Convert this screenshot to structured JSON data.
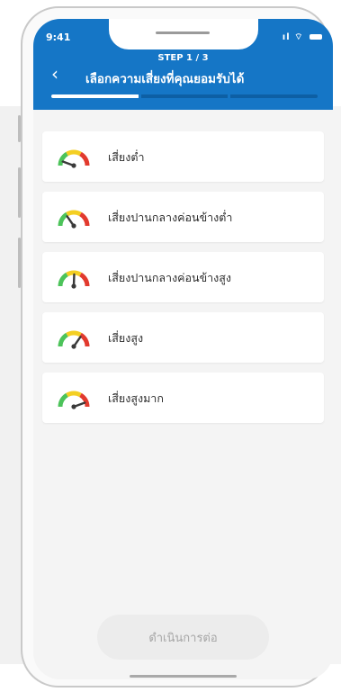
{
  "status_bar": {
    "time": "9:41",
    "icons": [
      "signal-icon",
      "wifi-icon",
      "battery-icon"
    ]
  },
  "header": {
    "back_icon": "chevron-left-icon",
    "step": "STEP 1 / 3",
    "title": "เลือกความเสี่ยงที่คุณยอมรับได้",
    "progress_fraction": 0.33,
    "progress_segments": 3
  },
  "options": [
    {
      "label": "เสี่ยงต่ำ",
      "icon": "gauge-low-icon",
      "level": 1
    },
    {
      "label": "เสี่ยงปานกลางค่อนข้างต่ำ",
      "icon": "gauge-medium-low-icon",
      "level": 2
    },
    {
      "label": "เสี่ยงปานกลางค่อนข้างสูง",
      "icon": "gauge-medium-high-icon",
      "level": 3
    },
    {
      "label": "เสี่ยงสูง",
      "icon": "gauge-high-icon",
      "level": 4
    },
    {
      "label": "เสี่ยงสูงมาก",
      "icon": "gauge-very-high-icon",
      "level": 5
    }
  ],
  "continue_button": {
    "label": "ดำเนินการต่อ",
    "enabled": false
  },
  "colors": {
    "header": "#1576c6",
    "gauge_green": "#4cc35a",
    "gauge_yellow": "#f4cf23",
    "gauge_red": "#e23a2e",
    "needle": "#3a3a3a"
  }
}
